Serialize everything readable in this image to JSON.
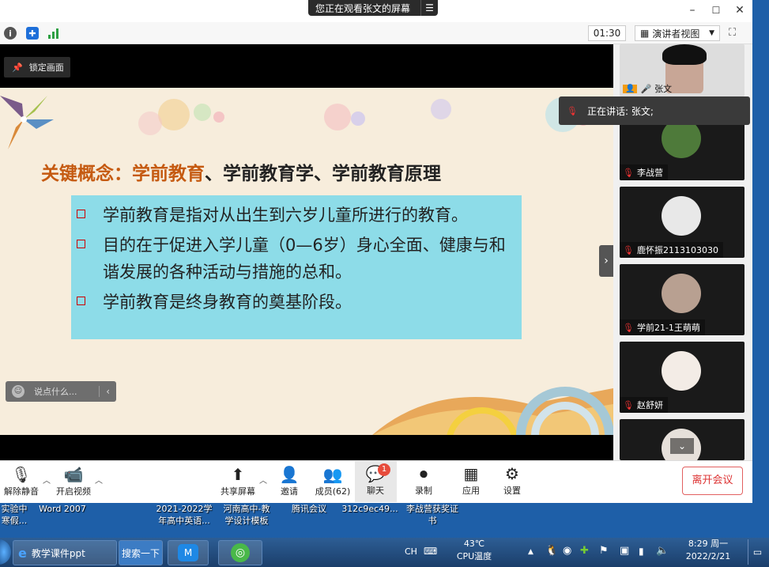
{
  "window": {
    "share_banner": "您正在观看张文的屏幕",
    "minimize": "–",
    "maximize": "☐",
    "close": "✕"
  },
  "infobar": {
    "timer": "01:30",
    "view_mode": "演讲者视图"
  },
  "stage": {
    "lock_label": "锁定画面",
    "comment_placeholder": "说点什么...",
    "slide": {
      "title_highlight": "关键概念：学前教育",
      "title_rest": "、学前教育学、学前教育原理",
      "bullets": [
        "学前教育是指对从出生到六岁儿童所进行的教育。",
        "目的在于促进入学儿童（0—6岁）身心全面、健康与和谐发展的各种活动与措施的总和。",
        "学前教育是终身教育的奠基阶段。"
      ]
    }
  },
  "gallery": {
    "speaking_label": "正在讲话: 张文;",
    "participants": [
      {
        "name": "张文",
        "avatar_color": "#cfd8e0"
      },
      {
        "name": "李战营",
        "avatar_color": "#4e7a3a"
      },
      {
        "name": "鹿怀振2113103030",
        "avatar_color": "#e8e8e8"
      },
      {
        "name": "学前21-1王萌萌",
        "avatar_color": "#b8a091"
      },
      {
        "name": "赵舒妍",
        "avatar_color": "#f3ece6"
      }
    ]
  },
  "toolbar": {
    "unmute": "解除静音",
    "start_video": "开启视频",
    "share_screen": "共享屏幕",
    "invite": "邀请",
    "members": "成员(62)",
    "chat": "聊天",
    "chat_badge": "1",
    "record": "录制",
    "apps": "应用",
    "settings": "设置",
    "leave": "离开会议"
  },
  "desktop_icons": [
    "实验中\n寒假...",
    "Word 2007",
    "2021-2022学\n年高中英语...",
    "河南高中-教\n学设计模板",
    "腾讯会议",
    "312c9ec49...",
    "李战营获奖证\n书"
  ],
  "taskbar": {
    "ie_label": "教学课件ppt",
    "search_label": "搜索一下",
    "lang": "CH",
    "temp": "43℃",
    "temp_label": "CPU温度",
    "time": "8:29 周一",
    "date": "2022/2/21"
  }
}
